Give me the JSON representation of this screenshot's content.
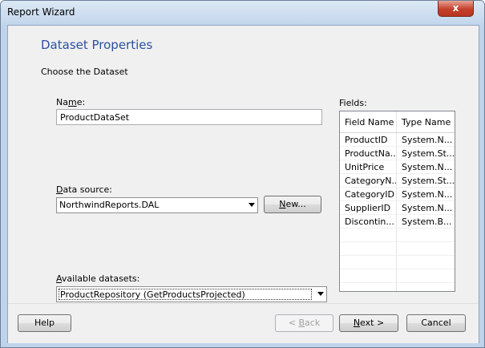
{
  "window": {
    "title": "Report Wizard",
    "close_glyph": "x"
  },
  "page": {
    "heading": "Dataset Properties",
    "subheading": "Choose the Dataset"
  },
  "name": {
    "label_prefix": "Na",
    "label_access": "m",
    "label_suffix": "e:",
    "value": "ProductDataSet"
  },
  "datasource": {
    "label_access": "D",
    "label_suffix": "ata source:",
    "value": "NorthwindReports.DAL",
    "new_access": "N",
    "new_suffix": "ew..."
  },
  "datasets": {
    "label_access": "A",
    "label_suffix": "vailable datasets:",
    "value": "ProductRepository (GetProductsProjected)"
  },
  "fields": {
    "label": "Fields:",
    "columns": [
      "Field Name",
      "Type Name"
    ],
    "rows": [
      [
        "ProductID",
        "System.N..."
      ],
      [
        "ProductNa...",
        "System.St..."
      ],
      [
        "UnitPrice",
        "System.N..."
      ],
      [
        "CategoryN...",
        "System.St..."
      ],
      [
        "CategoryID",
        "System.N..."
      ],
      [
        "SupplierID",
        "System.N..."
      ],
      [
        "Discontin...",
        "System.B..."
      ]
    ],
    "empty_rows": 6
  },
  "footer": {
    "help": "Help",
    "back_prefix": "< ",
    "back_access": "B",
    "back_suffix": "ack",
    "next_access": "N",
    "next_suffix": "ext >",
    "cancel": "Cancel"
  }
}
